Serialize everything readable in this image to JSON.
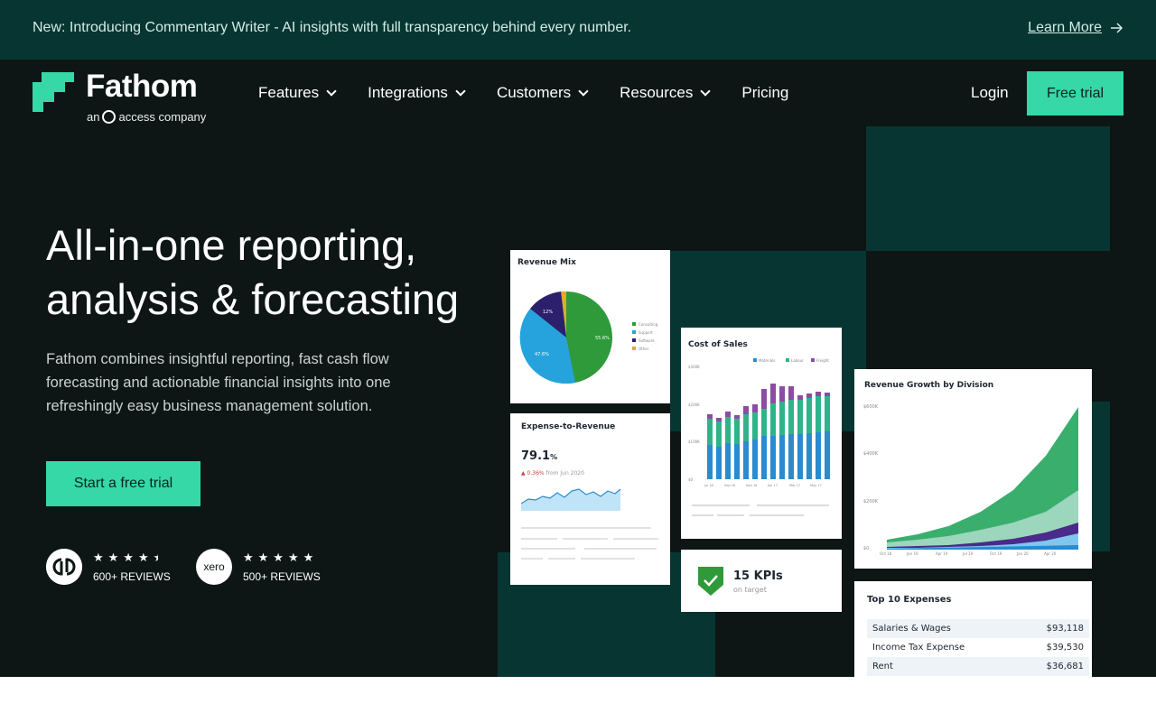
{
  "announcement": {
    "text": "New: Introducing Commentary Writer - AI insights with full transparency behind every number.",
    "link": "Learn More",
    "link_icon": "arrow-right-icon"
  },
  "brand": {
    "name": "Fathom",
    "sub_prefix": "an",
    "sub_suffix": "access company"
  },
  "nav": {
    "items": [
      {
        "label": "Features",
        "dropdown": true
      },
      {
        "label": "Integrations",
        "dropdown": true
      },
      {
        "label": "Customers",
        "dropdown": true
      },
      {
        "label": "Resources",
        "dropdown": true
      },
      {
        "label": "Pricing",
        "dropdown": false
      }
    ],
    "login": "Login",
    "trial": "Free trial"
  },
  "hero": {
    "headline_line1": "All-in-one reporting,",
    "headline_line2": "analysis & forecasting",
    "lede": "Fathom combines insightful reporting, fast cash flow forecasting and actionable financial insights into one refreshingly easy business management solution.",
    "cta": "Start a free trial"
  },
  "reviews": [
    {
      "badge": "qb",
      "icon": "quickbooks-icon",
      "rating": 4.5,
      "stars": "★★★★",
      "count": "600+ REVIEWS"
    },
    {
      "badge": "xero",
      "icon": "xero-icon",
      "rating": 5,
      "stars": "★★★★★",
      "count": "500+ REVIEWS"
    }
  ],
  "colors": {
    "accent": "#35d8a6",
    "dark": "#0d1615",
    "band": "#073632"
  },
  "cards": {
    "revenue_mix": {
      "title": "Revenue Mix",
      "legend": [
        "Consulting",
        "Support",
        "Software",
        "Other"
      ],
      "labels": [
        "55.6%",
        "47.6%",
        "12%"
      ]
    },
    "expense_revenue": {
      "title": "Expense-to-Revenue",
      "value": "79.1",
      "unit": "%",
      "delta": "0.36%",
      "delta_note": "from Jun 2020"
    },
    "cost_of_sales": {
      "title": "Cost of Sales",
      "legend": [
        "Materials",
        "Labour",
        "Freight"
      ],
      "y_ticks": [
        "$300K",
        "$200K",
        "$100K",
        "$0"
      ],
      "x_ticks": [
        "Jul 16",
        "Sep 16",
        "Nov 16",
        "Jan 17",
        "Mar 17",
        "May 17"
      ]
    },
    "kpis": {
      "value": "15 KPIs",
      "note": "on target"
    },
    "revenue_growth": {
      "title": "Revenue Growth by Division",
      "y_ticks": [
        "$600K",
        "$400K",
        "$200K",
        "$0"
      ],
      "x_ticks": [
        "Oct 18",
        "Jan 19",
        "Apr 19",
        "Jul 19",
        "Oct 19",
        "Jan 20",
        "Apr 20"
      ]
    },
    "top_expenses": {
      "title": "Top 10 Expenses",
      "rows": [
        {
          "name": "Salaries & Wages",
          "value": "$93,118"
        },
        {
          "name": "Income Tax Expense",
          "value": "$39,530"
        },
        {
          "name": "Rent",
          "value": "$36,681"
        }
      ]
    }
  }
}
